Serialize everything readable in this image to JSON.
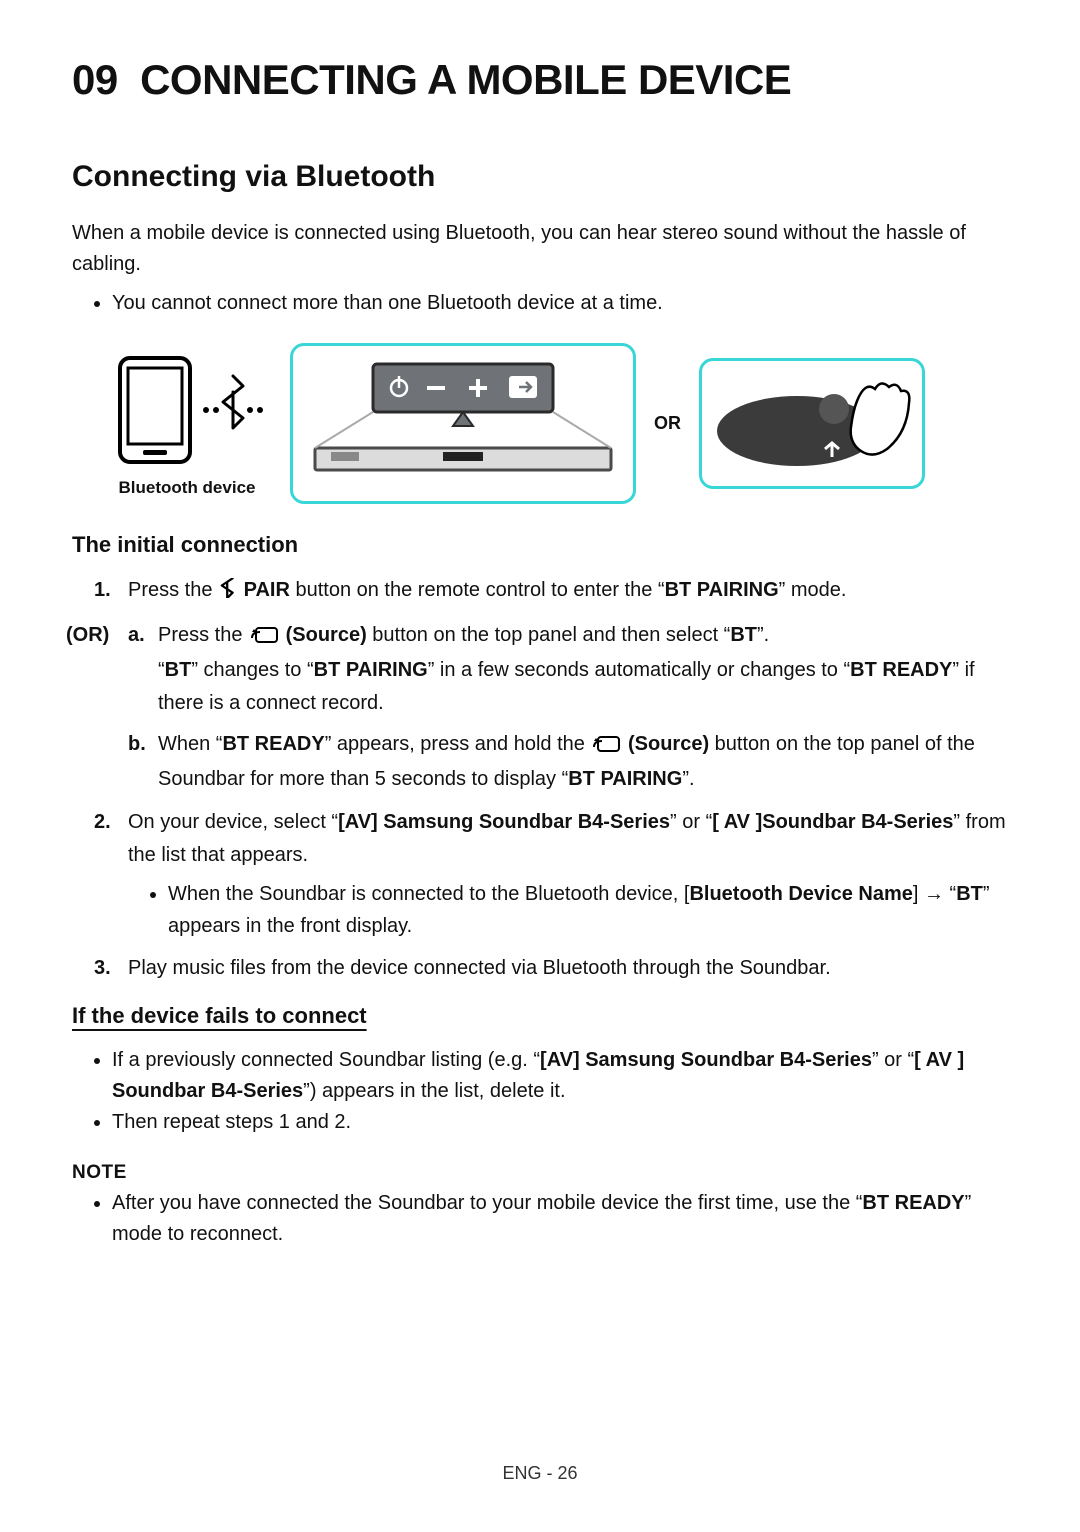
{
  "chapter": {
    "number": "09",
    "title": "CONNECTING A MOBILE DEVICE"
  },
  "section": {
    "title": "Connecting via Bluetooth"
  },
  "intro": "When a mobile device is connected using Bluetooth, you can hear stereo sound without the hassle of cabling.",
  "intro_bullet": "You cannot connect more than one Bluetooth device at a time.",
  "figure": {
    "bt_device_caption": "Bluetooth device",
    "or_label": "OR"
  },
  "initial": {
    "heading": "The initial connection",
    "step1": {
      "num": "1.",
      "pre": "Press the ",
      "pair_bold": " PAIR",
      "post": " button on the remote control to enter the “",
      "bt_pairing": "BT PAIRING",
      "end": "” mode."
    },
    "or_label": "(OR)",
    "step1a": {
      "al": "a.",
      "t1": "Press the ",
      "source_bold": " (Source)",
      "t2": " button on the top panel and then select “",
      "bt": "BT",
      "t3": "”.",
      "line2_a": "“",
      "line2_bt": "BT",
      "line2_b": "” changes to “",
      "line2_btpair": "BT PAIRING",
      "line2_c": "” in a few seconds automatically or changes to “",
      "line2_btready": "BT READY",
      "line2_d": "” if there is a connect record."
    },
    "step1b": {
      "al": "b.",
      "t1": "When “",
      "btready": "BT READY",
      "t2": "” appears, press and hold the ",
      "source_bold": " (Source)",
      "t3": " button on the top panel of the Soundbar for more than 5 seconds to display “",
      "btpair": "BT PAIRING",
      "t4": "”."
    },
    "step2": {
      "num": "2.",
      "t1": "On your device, select “",
      "name1": "[AV] Samsung Soundbar B4-Series",
      "t2": "” or “",
      "name2": "[ AV ]Soundbar B4-Series",
      "t3": "” from the list that appears.",
      "sub_t1": "When the Soundbar is connected to the Bluetooth device, [",
      "sub_bold": "Bluetooth Device Name",
      "sub_t2": "] → “",
      "sub_bt": "BT",
      "sub_t3": "” appears in the front display."
    },
    "step3": {
      "num": "3.",
      "text": "Play music files from the device connected via Bluetooth through the Soundbar."
    }
  },
  "fail": {
    "heading": "If the device fails to connect",
    "b1_a": "If a previously connected Soundbar listing (e.g. “",
    "b1_n1": "[AV] Samsung Soundbar B4-Series",
    "b1_b": "” or “",
    "b1_n2": "[ AV ] Soundbar B4-Series",
    "b1_c": "”) appears in the list, delete it.",
    "b2": "Then repeat steps 1 and 2."
  },
  "note": {
    "label": "NOTE",
    "b1_a": "After you have connected the Soundbar to your mobile device the first time, use the “",
    "b1_bold": "BT READY",
    "b1_b": "” mode to reconnect."
  },
  "footer": "ENG - 26"
}
